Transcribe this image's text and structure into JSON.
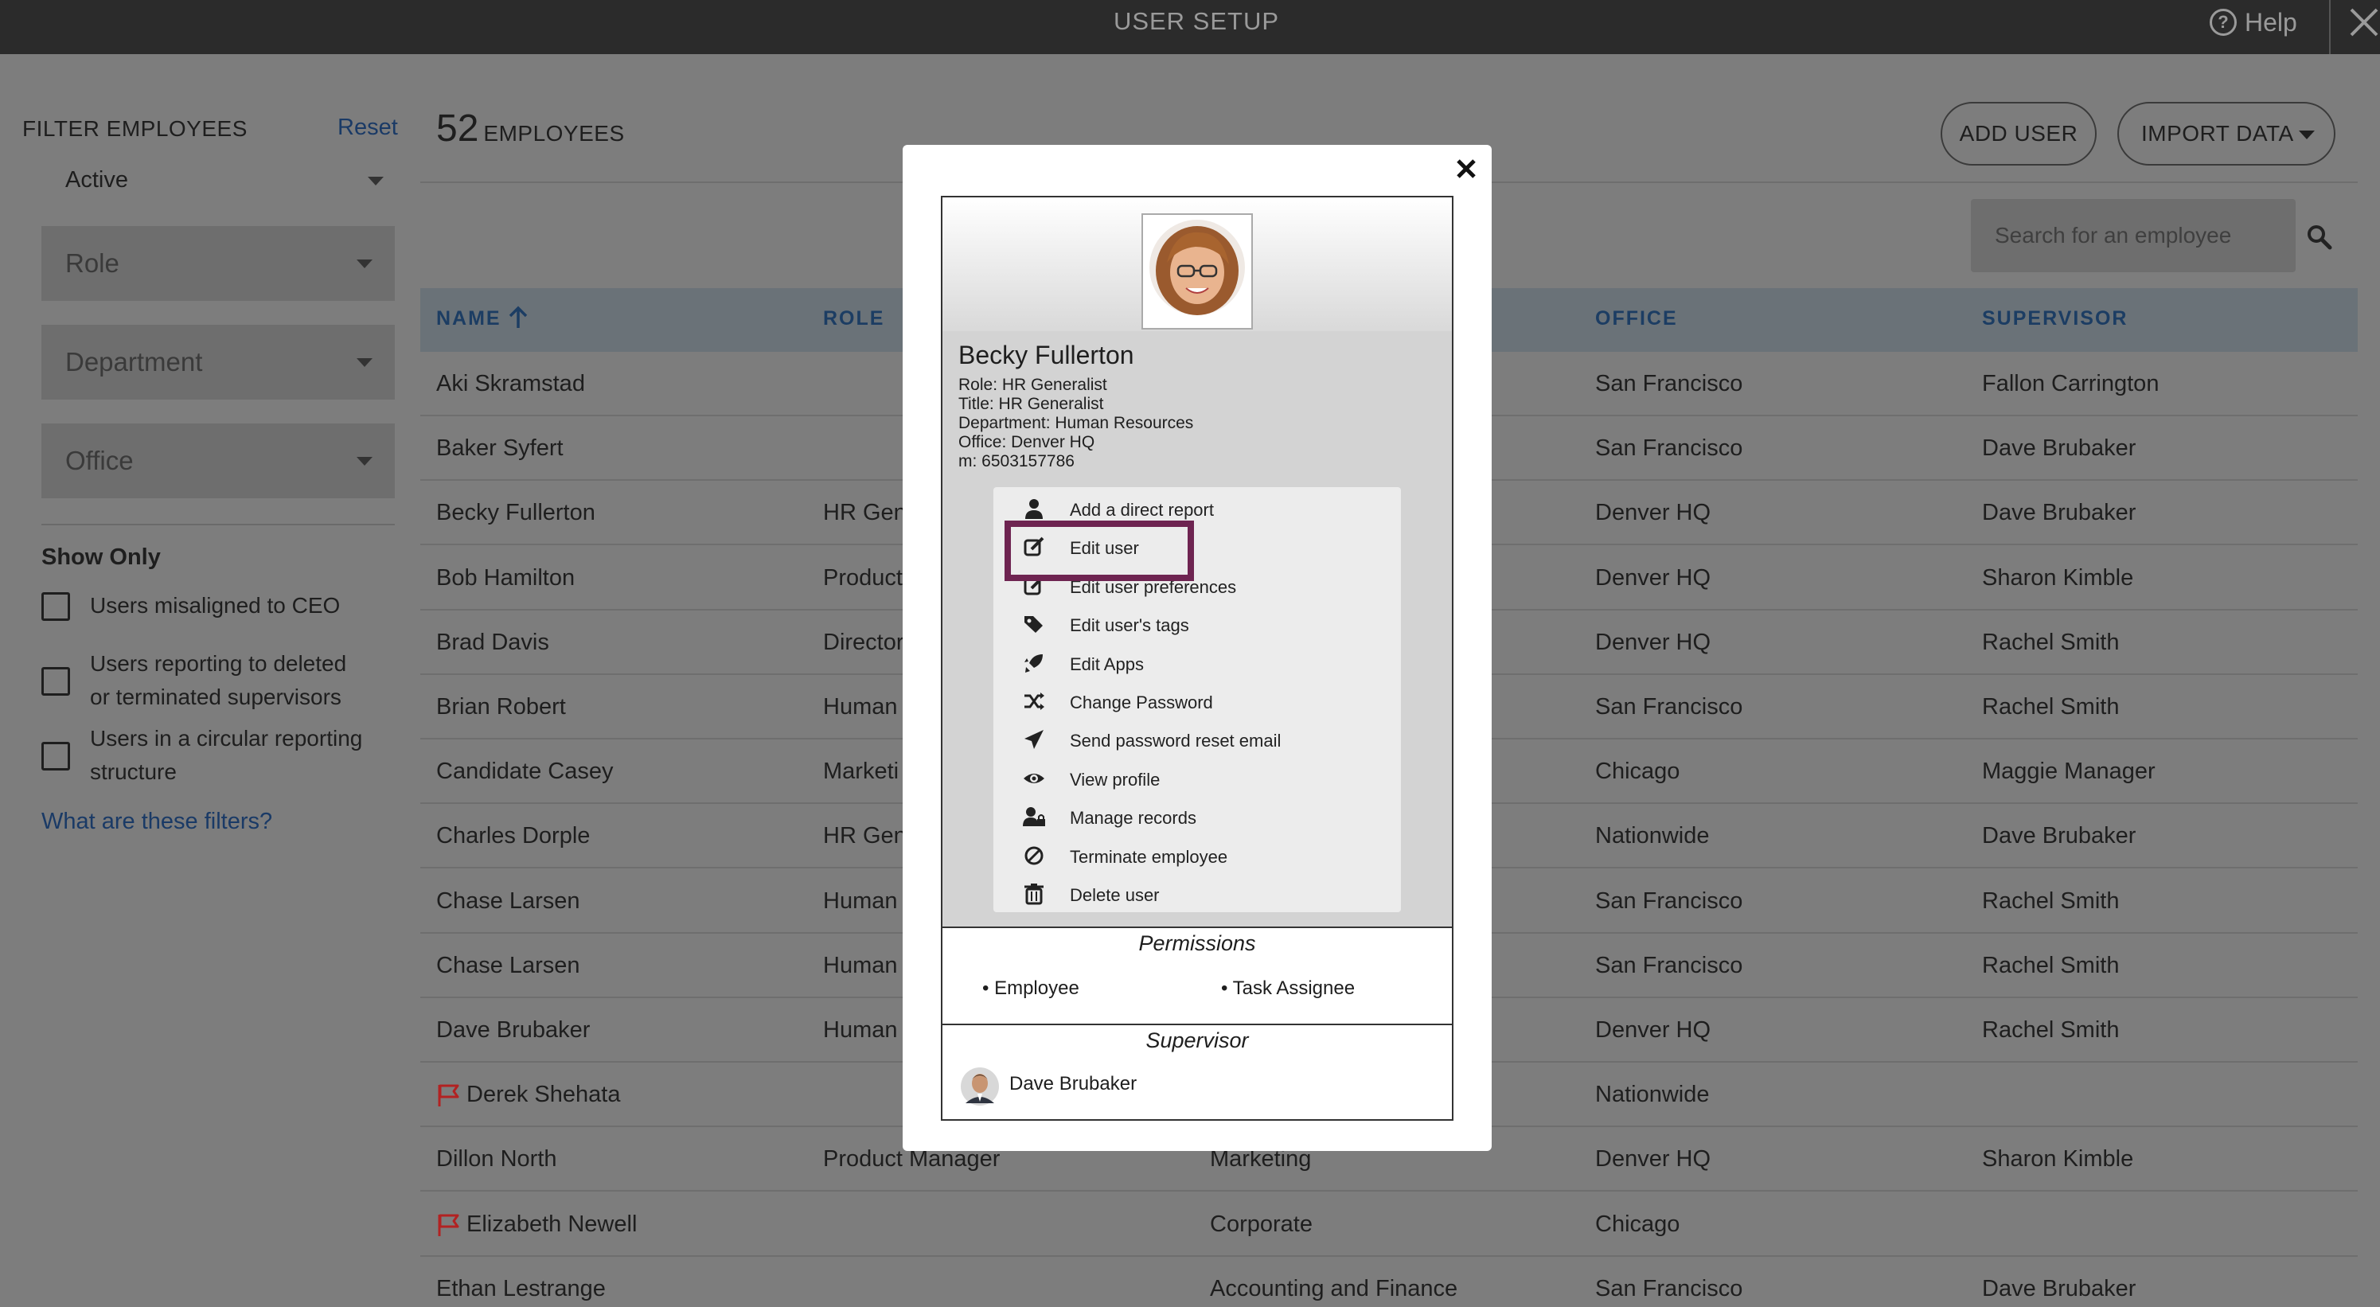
{
  "app": {
    "title": "USER SETUP",
    "help_label": "Help"
  },
  "filters": {
    "title": "FILTER EMPLOYEES",
    "reset": "Reset",
    "status_value": "Active",
    "role_placeholder": "Role",
    "department_placeholder": "Department",
    "office_placeholder": "Office",
    "show_only_title": "Show Only",
    "checkbox_1": "Users misaligned to CEO",
    "checkbox_2_line1": "Users reporting to deleted",
    "checkbox_2_line2": "or terminated supervisors",
    "checkbox_3_line1": "Users in a circular reporting",
    "checkbox_3_line2": "structure",
    "help_link": "What are these filters?"
  },
  "list": {
    "count": "52",
    "count_label": "EMPLOYEES",
    "add_user": "ADD USER",
    "import_data": "IMPORT DATA",
    "search_placeholder": "Search for an employee",
    "columns": {
      "name": "NAME",
      "role": "ROLE",
      "office": "OFFICE",
      "supervisor": "SUPERVISOR"
    },
    "rows": [
      {
        "name": "Aki Skramstad",
        "role": "",
        "dept": "",
        "office": "San Francisco",
        "supervisor": "Fallon Carrington",
        "flag": false
      },
      {
        "name": "Baker Syfert",
        "role": "",
        "dept": "",
        "office": "San Francisco",
        "supervisor": "Dave Brubaker",
        "flag": false
      },
      {
        "name": "Becky Fullerton",
        "role": "HR Gene",
        "dept": "",
        "office": "Denver HQ",
        "supervisor": "Dave Brubaker",
        "flag": false
      },
      {
        "name": "Bob Hamilton",
        "role": "Product",
        "dept": "",
        "office": "Denver HQ",
        "supervisor": "Sharon Kimble",
        "flag": false
      },
      {
        "name": "Brad Davis",
        "role": "Director",
        "dept": "",
        "office": "Denver HQ",
        "supervisor": "Rachel Smith",
        "flag": false
      },
      {
        "name": "Brian Robert",
        "role": "Human",
        "dept": "",
        "office": "San Francisco",
        "supervisor": "Rachel Smith",
        "flag": false
      },
      {
        "name": "Candidate Casey",
        "role": "Marketi",
        "dept": "",
        "office": "Chicago",
        "supervisor": "Maggie Manager",
        "flag": false
      },
      {
        "name": "Charles Dorple",
        "role": "HR Gene",
        "dept": "",
        "office": "Nationwide",
        "supervisor": "Dave Brubaker",
        "flag": false
      },
      {
        "name": "Chase Larsen",
        "role": "Human",
        "dept": "",
        "office": "San Francisco",
        "supervisor": "Rachel Smith",
        "flag": false
      },
      {
        "name": "Chase Larsen",
        "role": "Human",
        "dept": "",
        "office": "San Francisco",
        "supervisor": "Rachel Smith",
        "flag": false
      },
      {
        "name": "Dave Brubaker",
        "role": "Human",
        "dept": "",
        "office": "Denver HQ",
        "supervisor": "Rachel Smith",
        "flag": false
      },
      {
        "name": "Derek Shehata",
        "role": "",
        "dept": "",
        "office": "Nationwide",
        "supervisor": "",
        "flag": true
      },
      {
        "name": "Dillon North",
        "role": "Product Manager",
        "dept": "Marketing",
        "office": "Denver HQ",
        "supervisor": "Sharon Kimble",
        "flag": false
      },
      {
        "name": "Elizabeth Newell",
        "role": "",
        "dept": "Corporate",
        "office": "Chicago",
        "supervisor": "",
        "flag": true
      },
      {
        "name": "Ethan Lestrange",
        "role": "",
        "dept": "Accounting and Finance",
        "office": "San Francisco",
        "supervisor": "Dave Brubaker",
        "flag": false
      }
    ]
  },
  "modal": {
    "name": "Becky Fullerton",
    "role": "Role: HR Generalist",
    "title": "Title: HR Generalist",
    "department": "Department: Human Resources",
    "office": "Office: Denver HQ",
    "mobile": "m: 6503157786",
    "menu": [
      {
        "label": "Add a direct report",
        "icon": "person-icon"
      },
      {
        "label": "Edit user",
        "icon": "edit-icon"
      },
      {
        "label": "Edit user preferences",
        "icon": "edit-icon"
      },
      {
        "label": "Edit user's tags",
        "icon": "tags-icon"
      },
      {
        "label": "Edit Apps",
        "icon": "rocket-icon"
      },
      {
        "label": "Change Password",
        "icon": "shuffle-icon"
      },
      {
        "label": "Send password reset email",
        "icon": "paper-plane-icon"
      },
      {
        "label": "View profile",
        "icon": "eye-icon"
      },
      {
        "label": "Manage records",
        "icon": "user-lock-icon"
      },
      {
        "label": "Terminate employee",
        "icon": "ban-icon"
      },
      {
        "label": "Delete user",
        "icon": "trash-icon"
      }
    ],
    "permissions_title": "Permissions",
    "permissions": [
      "• Employee",
      "• Task Assignee"
    ],
    "supervisor_title": "Supervisor",
    "supervisor_name": "Dave Brubaker"
  },
  "colors": {
    "highlight": "#6e2451",
    "link": "#1a3a66",
    "flag": "#b22222"
  }
}
